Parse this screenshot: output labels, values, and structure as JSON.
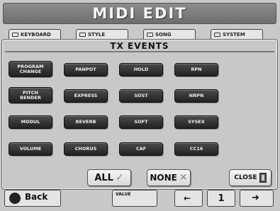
{
  "header": {
    "title": "MIDI EDIT"
  },
  "background_tabs": [
    "KEYBOARD",
    "STYLE",
    "SONG",
    "SYSTEM"
  ],
  "popup": {
    "title": "TX EVENTS",
    "events": [
      "PROGRAM\nCHANGE",
      "PANPOT",
      "HOLD",
      "RPN",
      "PITCH\nBENDER",
      "EXPRESS",
      "SOST",
      "NRPN",
      "MODUL",
      "REVERB",
      "SOFT",
      "SYSEX",
      "VOLUME",
      "CHORUS",
      "CAF",
      "CC16"
    ],
    "all_label": "ALL",
    "all_symbol": "✓",
    "none_label": "NONE",
    "none_symbol": "✕",
    "close_label": "CLOSE"
  },
  "bottom_bar": {
    "back_label": "Back",
    "value_label": "VALUE",
    "page_number": "1"
  }
}
